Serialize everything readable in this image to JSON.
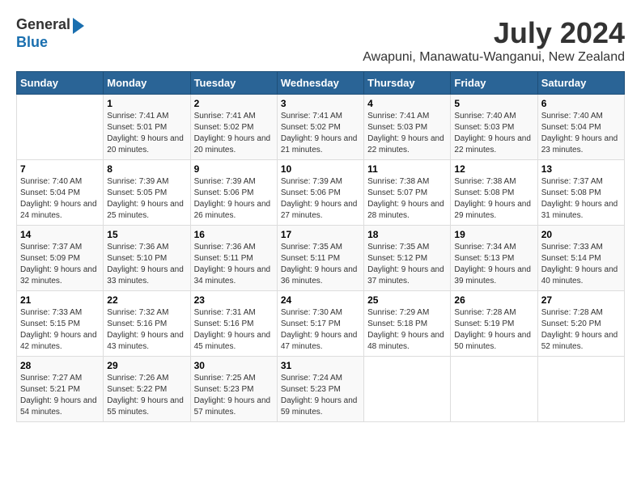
{
  "logo": {
    "general": "General",
    "blue": "Blue"
  },
  "title": "July 2024",
  "location": "Awapuni, Manawatu-Wanganui, New Zealand",
  "weekdays": [
    "Sunday",
    "Monday",
    "Tuesday",
    "Wednesday",
    "Thursday",
    "Friday",
    "Saturday"
  ],
  "weeks": [
    [
      {
        "day": "",
        "sunrise": "",
        "sunset": "",
        "daylight": ""
      },
      {
        "day": "1",
        "sunrise": "Sunrise: 7:41 AM",
        "sunset": "Sunset: 5:01 PM",
        "daylight": "Daylight: 9 hours and 20 minutes."
      },
      {
        "day": "2",
        "sunrise": "Sunrise: 7:41 AM",
        "sunset": "Sunset: 5:02 PM",
        "daylight": "Daylight: 9 hours and 20 minutes."
      },
      {
        "day": "3",
        "sunrise": "Sunrise: 7:41 AM",
        "sunset": "Sunset: 5:02 PM",
        "daylight": "Daylight: 9 hours and 21 minutes."
      },
      {
        "day": "4",
        "sunrise": "Sunrise: 7:41 AM",
        "sunset": "Sunset: 5:03 PM",
        "daylight": "Daylight: 9 hours and 22 minutes."
      },
      {
        "day": "5",
        "sunrise": "Sunrise: 7:40 AM",
        "sunset": "Sunset: 5:03 PM",
        "daylight": "Daylight: 9 hours and 22 minutes."
      },
      {
        "day": "6",
        "sunrise": "Sunrise: 7:40 AM",
        "sunset": "Sunset: 5:04 PM",
        "daylight": "Daylight: 9 hours and 23 minutes."
      }
    ],
    [
      {
        "day": "7",
        "sunrise": "Sunrise: 7:40 AM",
        "sunset": "Sunset: 5:04 PM",
        "daylight": "Daylight: 9 hours and 24 minutes."
      },
      {
        "day": "8",
        "sunrise": "Sunrise: 7:39 AM",
        "sunset": "Sunset: 5:05 PM",
        "daylight": "Daylight: 9 hours and 25 minutes."
      },
      {
        "day": "9",
        "sunrise": "Sunrise: 7:39 AM",
        "sunset": "Sunset: 5:06 PM",
        "daylight": "Daylight: 9 hours and 26 minutes."
      },
      {
        "day": "10",
        "sunrise": "Sunrise: 7:39 AM",
        "sunset": "Sunset: 5:06 PM",
        "daylight": "Daylight: 9 hours and 27 minutes."
      },
      {
        "day": "11",
        "sunrise": "Sunrise: 7:38 AM",
        "sunset": "Sunset: 5:07 PM",
        "daylight": "Daylight: 9 hours and 28 minutes."
      },
      {
        "day": "12",
        "sunrise": "Sunrise: 7:38 AM",
        "sunset": "Sunset: 5:08 PM",
        "daylight": "Daylight: 9 hours and 29 minutes."
      },
      {
        "day": "13",
        "sunrise": "Sunrise: 7:37 AM",
        "sunset": "Sunset: 5:08 PM",
        "daylight": "Daylight: 9 hours and 31 minutes."
      }
    ],
    [
      {
        "day": "14",
        "sunrise": "Sunrise: 7:37 AM",
        "sunset": "Sunset: 5:09 PM",
        "daylight": "Daylight: 9 hours and 32 minutes."
      },
      {
        "day": "15",
        "sunrise": "Sunrise: 7:36 AM",
        "sunset": "Sunset: 5:10 PM",
        "daylight": "Daylight: 9 hours and 33 minutes."
      },
      {
        "day": "16",
        "sunrise": "Sunrise: 7:36 AM",
        "sunset": "Sunset: 5:11 PM",
        "daylight": "Daylight: 9 hours and 34 minutes."
      },
      {
        "day": "17",
        "sunrise": "Sunrise: 7:35 AM",
        "sunset": "Sunset: 5:11 PM",
        "daylight": "Daylight: 9 hours and 36 minutes."
      },
      {
        "day": "18",
        "sunrise": "Sunrise: 7:35 AM",
        "sunset": "Sunset: 5:12 PM",
        "daylight": "Daylight: 9 hours and 37 minutes."
      },
      {
        "day": "19",
        "sunrise": "Sunrise: 7:34 AM",
        "sunset": "Sunset: 5:13 PM",
        "daylight": "Daylight: 9 hours and 39 minutes."
      },
      {
        "day": "20",
        "sunrise": "Sunrise: 7:33 AM",
        "sunset": "Sunset: 5:14 PM",
        "daylight": "Daylight: 9 hours and 40 minutes."
      }
    ],
    [
      {
        "day": "21",
        "sunrise": "Sunrise: 7:33 AM",
        "sunset": "Sunset: 5:15 PM",
        "daylight": "Daylight: 9 hours and 42 minutes."
      },
      {
        "day": "22",
        "sunrise": "Sunrise: 7:32 AM",
        "sunset": "Sunset: 5:16 PM",
        "daylight": "Daylight: 9 hours and 43 minutes."
      },
      {
        "day": "23",
        "sunrise": "Sunrise: 7:31 AM",
        "sunset": "Sunset: 5:16 PM",
        "daylight": "Daylight: 9 hours and 45 minutes."
      },
      {
        "day": "24",
        "sunrise": "Sunrise: 7:30 AM",
        "sunset": "Sunset: 5:17 PM",
        "daylight": "Daylight: 9 hours and 47 minutes."
      },
      {
        "day": "25",
        "sunrise": "Sunrise: 7:29 AM",
        "sunset": "Sunset: 5:18 PM",
        "daylight": "Daylight: 9 hours and 48 minutes."
      },
      {
        "day": "26",
        "sunrise": "Sunrise: 7:28 AM",
        "sunset": "Sunset: 5:19 PM",
        "daylight": "Daylight: 9 hours and 50 minutes."
      },
      {
        "day": "27",
        "sunrise": "Sunrise: 7:28 AM",
        "sunset": "Sunset: 5:20 PM",
        "daylight": "Daylight: 9 hours and 52 minutes."
      }
    ],
    [
      {
        "day": "28",
        "sunrise": "Sunrise: 7:27 AM",
        "sunset": "Sunset: 5:21 PM",
        "daylight": "Daylight: 9 hours and 54 minutes."
      },
      {
        "day": "29",
        "sunrise": "Sunrise: 7:26 AM",
        "sunset": "Sunset: 5:22 PM",
        "daylight": "Daylight: 9 hours and 55 minutes."
      },
      {
        "day": "30",
        "sunrise": "Sunrise: 7:25 AM",
        "sunset": "Sunset: 5:23 PM",
        "daylight": "Daylight: 9 hours and 57 minutes."
      },
      {
        "day": "31",
        "sunrise": "Sunrise: 7:24 AM",
        "sunset": "Sunset: 5:23 PM",
        "daylight": "Daylight: 9 hours and 59 minutes."
      },
      {
        "day": "",
        "sunrise": "",
        "sunset": "",
        "daylight": ""
      },
      {
        "day": "",
        "sunrise": "",
        "sunset": "",
        "daylight": ""
      },
      {
        "day": "",
        "sunrise": "",
        "sunset": "",
        "daylight": ""
      }
    ]
  ]
}
